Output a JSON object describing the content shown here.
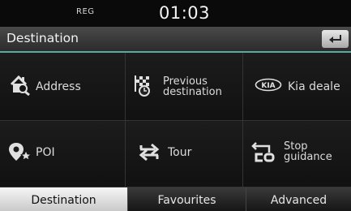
{
  "status": {
    "label": "REG",
    "time": "01:03"
  },
  "header": {
    "title": "Destination"
  },
  "menu": {
    "address": "Address",
    "previous_line1": "Previous",
    "previous_line2": "destination",
    "kia_dealer": "Kia deale",
    "poi": "POI",
    "tour": "Tour",
    "stop_line1": "Stop",
    "stop_line2": "guidance",
    "kia_logo_text": "KIA"
  },
  "tabs": {
    "destination": "Destination",
    "favourites": "Favourites",
    "advanced": "Advanced"
  },
  "colors": {
    "accent": "#5aa9a1",
    "background": "#080808",
    "text": "#dcdcdc"
  }
}
